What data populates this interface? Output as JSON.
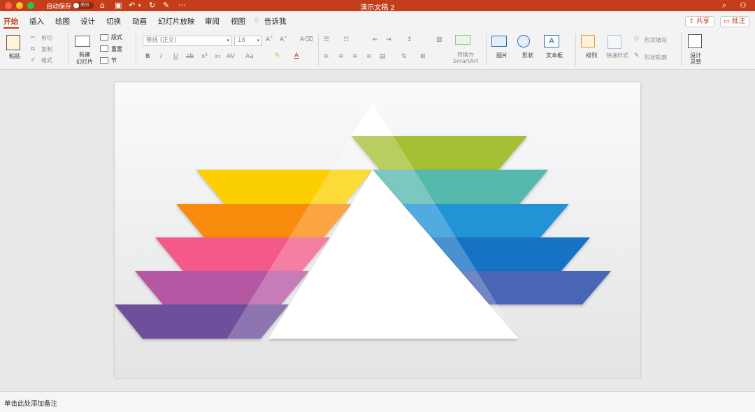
{
  "titlebar": {
    "autosave_label": "自动保存",
    "autosave_state": "关闭",
    "window_title": "演示文稿 2",
    "bg_color": "#c43e1c"
  },
  "tabs": [
    "开始",
    "插入",
    "绘图",
    "设计",
    "切换",
    "动画",
    "幻灯片放映",
    "审阅",
    "视图"
  ],
  "active_tab": "开始",
  "tell_me": "告诉我",
  "share_button": "共享",
  "comments_button": "批注",
  "ribbon": {
    "paste": "粘贴",
    "cut": "剪切",
    "copy": "复制",
    "format_painter": "格式",
    "new_slide_1": "新建",
    "new_slide_2": "幻灯片",
    "layout": "版式",
    "reset": "重置",
    "section": "节",
    "font_name": "等线 (正文)",
    "font_size": "18",
    "convert_1": "转换为",
    "convert_2": "SmartArt",
    "picture": "图片",
    "shapes": "形状",
    "textbox": "文本框",
    "arrange": "排列",
    "quick_styles": "快速样式",
    "shape_fill": "形状填充",
    "shape_outline": "形状轮廓",
    "designer_1": "设计",
    "designer_2": "灵感"
  },
  "notes_placeholder": "单击此处添加备注",
  "slide_graphic": {
    "left_bands": [
      "#fcd000",
      "#f98b0c",
      "#f35a8a",
      "#b558a4",
      "#6e4f9c"
    ],
    "right_bands": [
      "#a6c034",
      "#55b9ad",
      "#2494d6",
      "#1472c4",
      "#4866b4"
    ],
    "center_triangle": "#ffffff"
  }
}
